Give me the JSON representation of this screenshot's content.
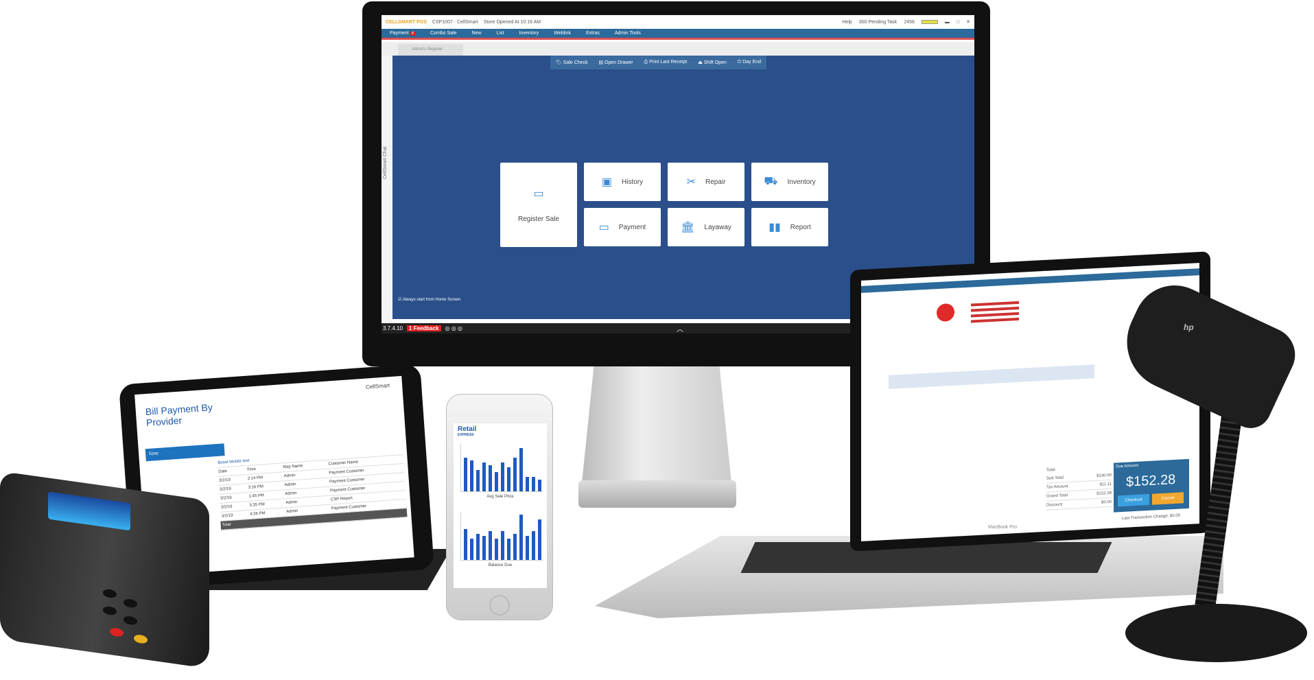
{
  "monitor": {
    "app_name": "CELLSMART POS",
    "store_info": "CSP1007 · CellSmart",
    "store_opened": "Store Opened At 10:16 AM",
    "help": "Help",
    "pending": "300 Pending Task",
    "counter": "2456",
    "menu": [
      "Payment",
      "Combo Sale",
      "New",
      "List",
      "Inventory",
      "Weblink",
      "Extras",
      "Admin Tools"
    ],
    "payment_badge": "4",
    "register_tab": "Admin's Register",
    "side_label": "CellSmart Chat",
    "actions": [
      "Sale Check",
      "Open Drawer",
      "Print Last Receipt",
      "Shift Open",
      "Day End"
    ],
    "tiles": [
      {
        "label": "Register Sale",
        "icon": "register-icon"
      },
      {
        "label": "History",
        "icon": "history-icon"
      },
      {
        "label": "Repair",
        "icon": "tools-icon"
      },
      {
        "label": "Inventory",
        "icon": "dolly-icon"
      },
      {
        "label": "Payment",
        "icon": "card-icon"
      },
      {
        "label": "Layaway",
        "icon": "bank-icon"
      },
      {
        "label": "Report",
        "icon": "bar-chart-icon"
      }
    ],
    "home_checkbox": "Always start from Home Screen",
    "home_checked": true,
    "version": "3.7.4.10",
    "feedback": "1 Feedback",
    "accent": "#2b4f8a"
  },
  "laptop": {
    "brand": "MacBook Pro",
    "total_label": "Total",
    "totals": [
      {
        "label": "Sub Total",
        "value": "$140.00"
      },
      {
        "label": "Tax Amount",
        "value": "$11.11"
      },
      {
        "label": "Grand Total",
        "value": "$152.28"
      },
      {
        "label": "Discount",
        "value": "$0.00"
      }
    ],
    "due_label": "Due Amount",
    "due_amount": "$152.28",
    "checkout": "Checkout",
    "cancel": "Cancel",
    "last_transaction": "Last Transaction Change: $0.00"
  },
  "tablet": {
    "brand": "CellSmart",
    "title": "Bill Payment By Provider",
    "bar_label": "Epay",
    "section": "Boost Mobile test",
    "headers": [
      "Date",
      "Time",
      "Rep Name",
      "Customer Name"
    ],
    "rows": [
      [
        "3/2/19",
        "2:14 PM",
        "Admin",
        "Payment Customer"
      ],
      [
        "3/2/19",
        "3:16 PM",
        "Admin",
        "Payment Customer"
      ],
      [
        "3/2/19",
        "1:45 PM",
        "Admin",
        "Payment Customer"
      ],
      [
        "3/2/19",
        "3:35 PM",
        "Admin",
        "CSP Report"
      ],
      [
        "3/2/19",
        "4:36 PM",
        "Admin",
        "Payment Customer"
      ]
    ],
    "total_label": "Total"
  },
  "phone": {
    "logo": "Retail",
    "logo_sub": "EXPRESS",
    "chart1_caption": "Avg Sale Price",
    "chart2_caption": "Balance Due",
    "chart1_values": [
      70,
      65,
      45,
      60,
      55,
      40,
      60,
      50,
      70,
      90,
      30,
      30,
      25
    ],
    "chart2_values": [
      65,
      45,
      55,
      50,
      60,
      45,
      60,
      45,
      55,
      95,
      50,
      60,
      85
    ],
    "bar_color": "#1e5ac0"
  },
  "scanner": {
    "logo": "hp"
  }
}
